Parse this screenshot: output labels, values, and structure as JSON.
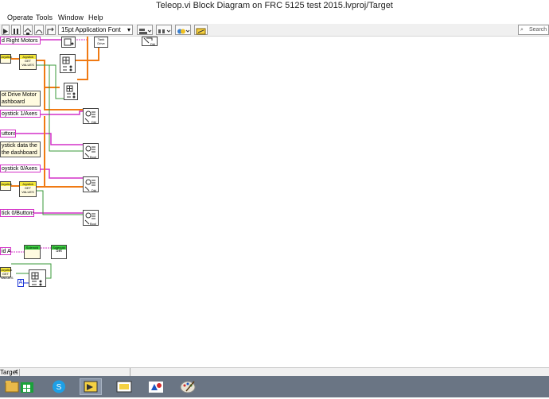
{
  "window": {
    "title": "Teleop.vi Block Diagram on FRC 5125 test 2015.lvproj/Target"
  },
  "menu": [
    "Operate",
    "Tools",
    "Window",
    "Help"
  ],
  "toolbar": {
    "font": "15pt Application Font",
    "search_placeholder": "Search"
  },
  "labels": {
    "left_right_motors": "d Right Motors",
    "tank_drive": "Tank Drive",
    "dbl": "Dbl",
    "bool": "Bool",
    "set": "Set",
    "get_values": "GET VALUES",
    "joystick": "Joystick",
    "solenoid": "Solenoid",
    "note1_line1": "ot Drive Motor",
    "note1_line2": "ashboard",
    "joystick1_axes": "oystick 1/Axes",
    "buttons": "uttons",
    "note2_line1": "ystick data the",
    "note2_line2": "the dashboard",
    "joystick0_axes": "oystick 0/Axes",
    "joystick0_buttons": "tick 0/Buttons",
    "solenoid_ctrl": "id A",
    "const_a": "A"
  },
  "tabs": {
    "target": "Target"
  },
  "colors": {
    "pink_wire": "#d431c8",
    "orange_wire": "#f07a13",
    "green_wire": "#3a9a3a",
    "blue_const": "#1b34d6"
  },
  "taskbar": [
    "file-explorer-icon",
    "windows-store-icon",
    "skype-icon",
    "labview-vi-icon",
    "labview-block-diagram-icon",
    "frc-driver-station-icon",
    "paint-icon"
  ]
}
